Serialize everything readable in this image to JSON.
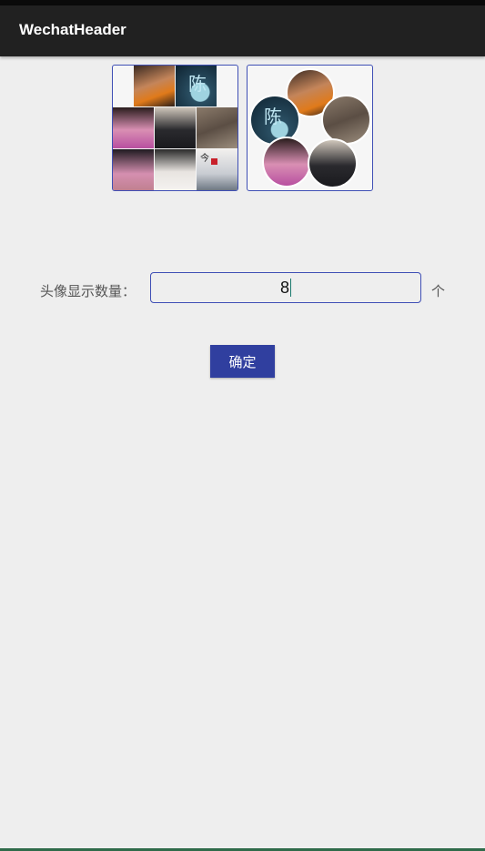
{
  "app": {
    "title": "WechatHeader"
  },
  "form": {
    "label": "头像显示数量：",
    "input_value": "8",
    "unit": "个",
    "confirm_label": "确定"
  },
  "icons": {
    "avatar_grid": "avatar-grid-icon",
    "avatar_circles": "avatar-circles-icon"
  },
  "colors": {
    "accent": "#303f9f",
    "appbar": "#212121",
    "background": "#eeeeee",
    "border": "#3f4fb5"
  }
}
